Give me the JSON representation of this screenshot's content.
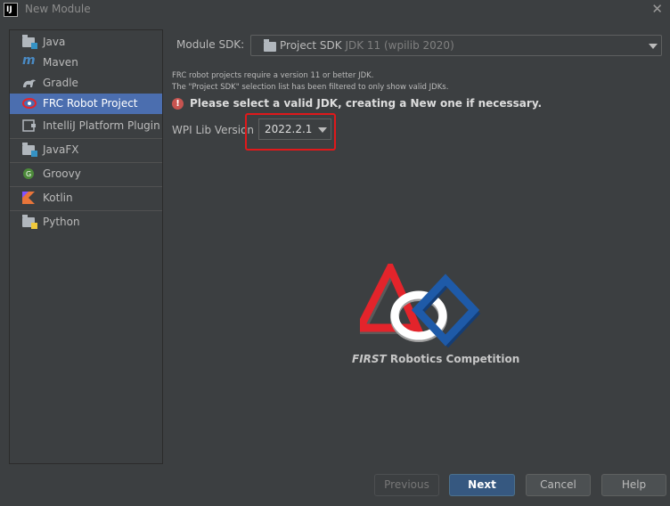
{
  "window": {
    "title": "New Module",
    "app_icon_text": "IJ"
  },
  "sidebar": {
    "items": [
      {
        "label": "Java",
        "icon": "java-folder-icon",
        "selected": false
      },
      {
        "label": "Maven",
        "icon": "maven-icon",
        "selected": false
      },
      {
        "label": "Gradle",
        "icon": "gradle-icon",
        "selected": false
      },
      {
        "label": "FRC Robot Project",
        "icon": "frc-icon",
        "selected": true
      },
      {
        "label": "IntelliJ Platform Plugin",
        "icon": "plugin-icon",
        "selected": false
      },
      {
        "label": "JavaFX",
        "icon": "javafx-folder-icon",
        "selected": false
      },
      {
        "label": "Groovy",
        "icon": "groovy-icon",
        "selected": false
      },
      {
        "label": "Kotlin",
        "icon": "kotlin-icon",
        "selected": false
      },
      {
        "label": "Python",
        "icon": "python-icon",
        "selected": false
      }
    ]
  },
  "main": {
    "sdk_label": "Module SDK:",
    "sdk_value": "Project SDK",
    "sdk_detail": "JDK 11 (wpilib 2020)",
    "note_line1": "FRC robot projects require a version 11 or better JDK.",
    "note_line2": "The \"Project SDK\" selection list has been filtered to only show valid JDKs.",
    "warning": "Please select a valid JDK, creating a New one if necessary.",
    "wpilib_label": "WPI Lib Version",
    "wpilib_value": "2022.2.1",
    "logo_caption_italic": "FIRST",
    "logo_caption_rest": " Robotics Competition"
  },
  "footer": {
    "previous": "Previous",
    "next": "Next",
    "cancel": "Cancel",
    "help": "Help"
  },
  "colors": {
    "background": "#3c3f41",
    "selection": "#4b6eaf",
    "primary_button": "#365880",
    "annotation_red": "#e0191b",
    "logo_red": "#e3242b",
    "logo_blue": "#1e5aa8"
  }
}
